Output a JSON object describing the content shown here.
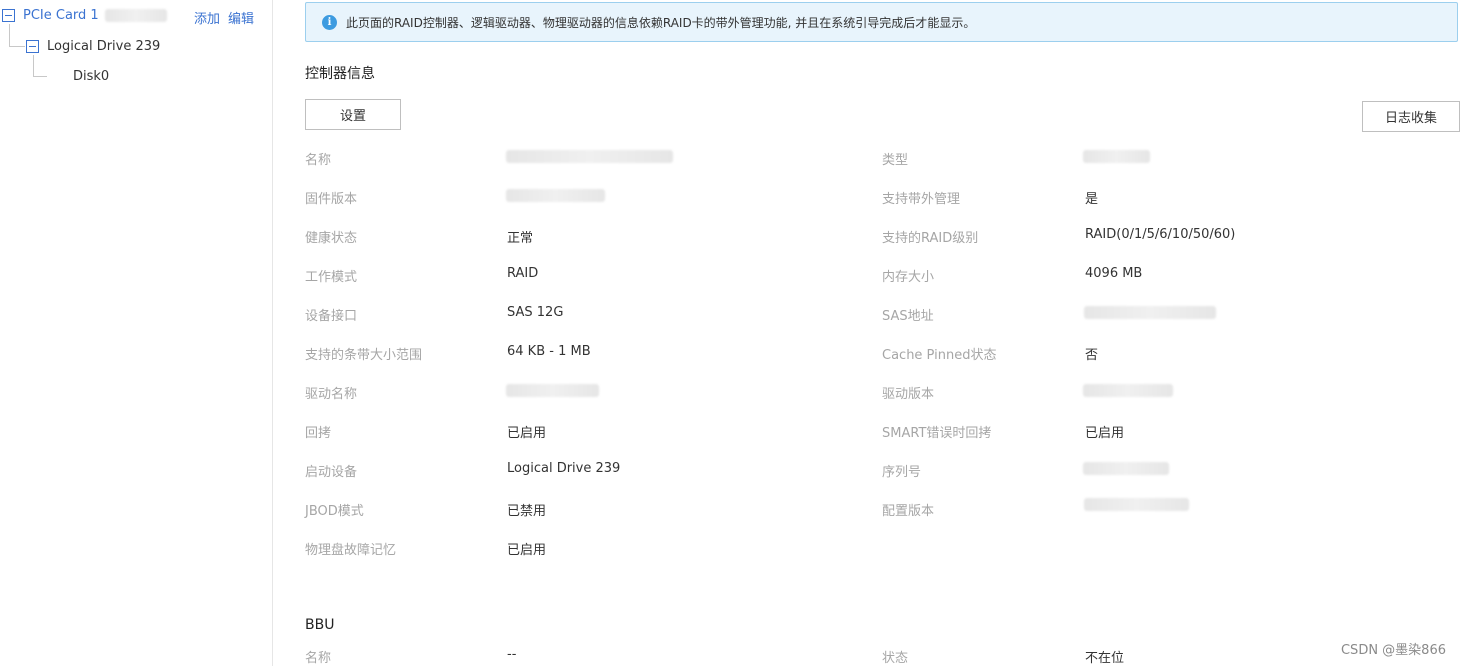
{
  "tree": {
    "root": {
      "label": "PCIe Card 1",
      "add_label": "添加",
      "edit_label": "编辑"
    },
    "logical_drive": {
      "label": "Logical Drive 239"
    },
    "disk": {
      "label": "Disk0"
    }
  },
  "notice": {
    "text": "此页面的RAID控制器、逻辑驱动器、物理驱动器的信息依赖RAID卡的带外管理功能, 并且在系统引导完成后才能显示。"
  },
  "controller": {
    "title": "控制器信息",
    "settings_button": "设置",
    "log_button": "日志收集",
    "left_fields": [
      {
        "label": "名称",
        "value": ""
      },
      {
        "label": "固件版本",
        "value": ""
      },
      {
        "label": "健康状态",
        "value": "正常"
      },
      {
        "label": "工作模式",
        "value": "RAID"
      },
      {
        "label": "设备接口",
        "value": "SAS 12G"
      },
      {
        "label": "支持的条带大小范围",
        "value": "64 KB - 1 MB"
      },
      {
        "label": "驱动名称",
        "value": ""
      },
      {
        "label": "回拷",
        "value": "已启用"
      },
      {
        "label": "启动设备",
        "value": "Logical Drive 239"
      },
      {
        "label": "JBOD模式",
        "value": "已禁用"
      },
      {
        "label": "物理盘故障记忆",
        "value": "已启用"
      }
    ],
    "right_fields": [
      {
        "label": "类型",
        "value": ""
      },
      {
        "label": "支持带外管理",
        "value": "是"
      },
      {
        "label": "支持的RAID级别",
        "value": "RAID(0/1/5/6/10/50/60)"
      },
      {
        "label": "内存大小",
        "value": "4096 MB"
      },
      {
        "label": "SAS地址",
        "value": ""
      },
      {
        "label": "Cache Pinned状态",
        "value": "否"
      },
      {
        "label": "驱动版本",
        "value": ""
      },
      {
        "label": "SMART错误时回拷",
        "value": "已启用"
      },
      {
        "label": "序列号",
        "value": ""
      },
      {
        "label": "配置版本",
        "value": ""
      }
    ]
  },
  "bbu": {
    "title": "BBU",
    "name_label": "名称",
    "name_value": "--",
    "status_label": "状态",
    "status_value": "不在位"
  },
  "watermark": "CSDN @墨染866"
}
